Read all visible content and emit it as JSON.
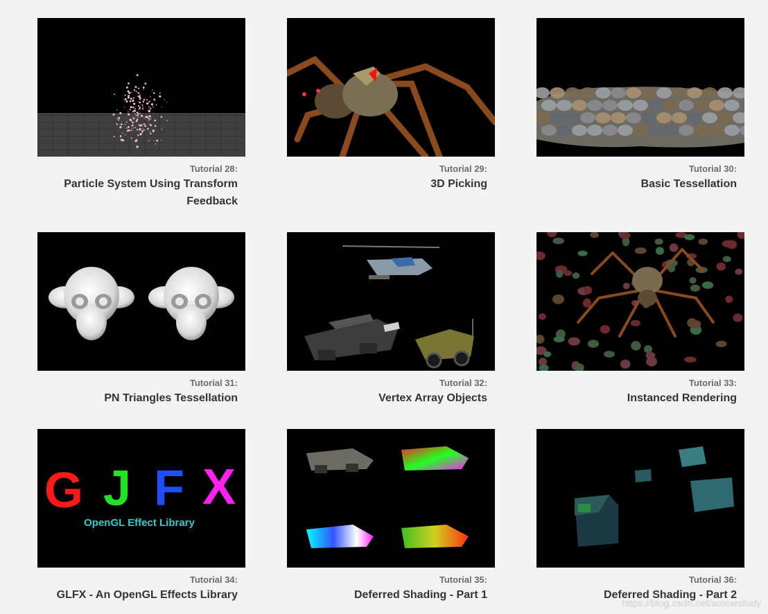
{
  "tutorials": [
    {
      "number": "Tutorial 28:",
      "title": "Particle System Using Transform Feedback",
      "image": "particle-system-screenshot"
    },
    {
      "number": "Tutorial 29:",
      "title": "3D Picking",
      "image": "spider-picking-screenshot"
    },
    {
      "number": "Tutorial 30:",
      "title": "Basic Tessellation",
      "image": "tessellated-terrain-screenshot"
    },
    {
      "number": "Tutorial 31:",
      "title": "PN Triangles Tessellation",
      "image": "monkey-heads-screenshot"
    },
    {
      "number": "Tutorial 32:",
      "title": "Vertex Array Objects",
      "image": "vehicles-screenshot"
    },
    {
      "number": "Tutorial 33:",
      "title": "Instanced Rendering",
      "image": "spider-swarm-screenshot"
    },
    {
      "number": "Tutorial 34:",
      "title": "GLFX - An OpenGL Effects Library",
      "image": "glfx-logo-screenshot",
      "logo_letters": "GLFX",
      "logo_caption": "OpenGL Effect Library"
    },
    {
      "number": "Tutorial 35:",
      "title": "Deferred Shading - Part 1",
      "image": "deferred-gbuffer-screenshot"
    },
    {
      "number": "Tutorial 36:",
      "title": "Deferred Shading - Part 2",
      "image": "deferred-cubes-screenshot"
    }
  ],
  "watermark": "https://blog.csdn.net/aoxuestudy",
  "colors": {
    "background": "#f3f3f3",
    "title": "#333333",
    "number": "#6b6b6b"
  }
}
